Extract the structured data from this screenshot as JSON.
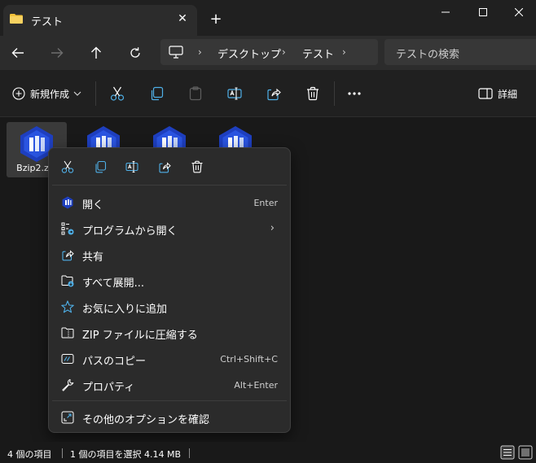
{
  "tab": {
    "title": "テスト",
    "close_glyph": "✕",
    "new_tab_glyph": "+"
  },
  "address": {
    "crumbs": [
      "デスクトップ",
      "テスト"
    ],
    "separator": "›"
  },
  "search": {
    "placeholder": "テストの検索"
  },
  "toolbar": {
    "new_label": "新規作成",
    "details_label": "詳細"
  },
  "files": [
    {
      "name": "Bzip2.zip",
      "selected": true
    },
    {
      "name": "",
      "selected": false
    },
    {
      "name": "",
      "selected": false
    },
    {
      "name": "",
      "selected": false
    }
  ],
  "context_menu": {
    "items": [
      {
        "label": "開く",
        "accelerator": "Enter",
        "icon": "app-icon"
      },
      {
        "label": "プログラムから開く",
        "accelerator": "",
        "icon": "open-with-icon",
        "submenu_arrow": "›"
      },
      {
        "label": "共有",
        "accelerator": "",
        "icon": "share-icon"
      },
      {
        "label": "すべて展開...",
        "accelerator": "",
        "icon": "extract-icon"
      },
      {
        "label": "お気に入りに追加",
        "accelerator": "",
        "icon": "star-icon"
      },
      {
        "label": "ZIP ファイルに圧縮する",
        "accelerator": "",
        "icon": "zip-folder-icon"
      },
      {
        "label": "パスのコピー",
        "accelerator": "Ctrl+Shift+C",
        "icon": "copy-path-icon"
      },
      {
        "label": "プロパティ",
        "accelerator": "Alt+Enter",
        "icon": "wrench-icon"
      },
      {
        "label": "その他のオプションを確認",
        "accelerator": "",
        "icon": "more-options-icon"
      }
    ]
  },
  "status": {
    "item_count": "4 個の項目",
    "selection": "1 個の項目を選択  4.14 MB"
  },
  "colors": {
    "accent": "#1e3fbf",
    "window_bg": "#191919",
    "menu_bg": "#2b2b2b"
  }
}
